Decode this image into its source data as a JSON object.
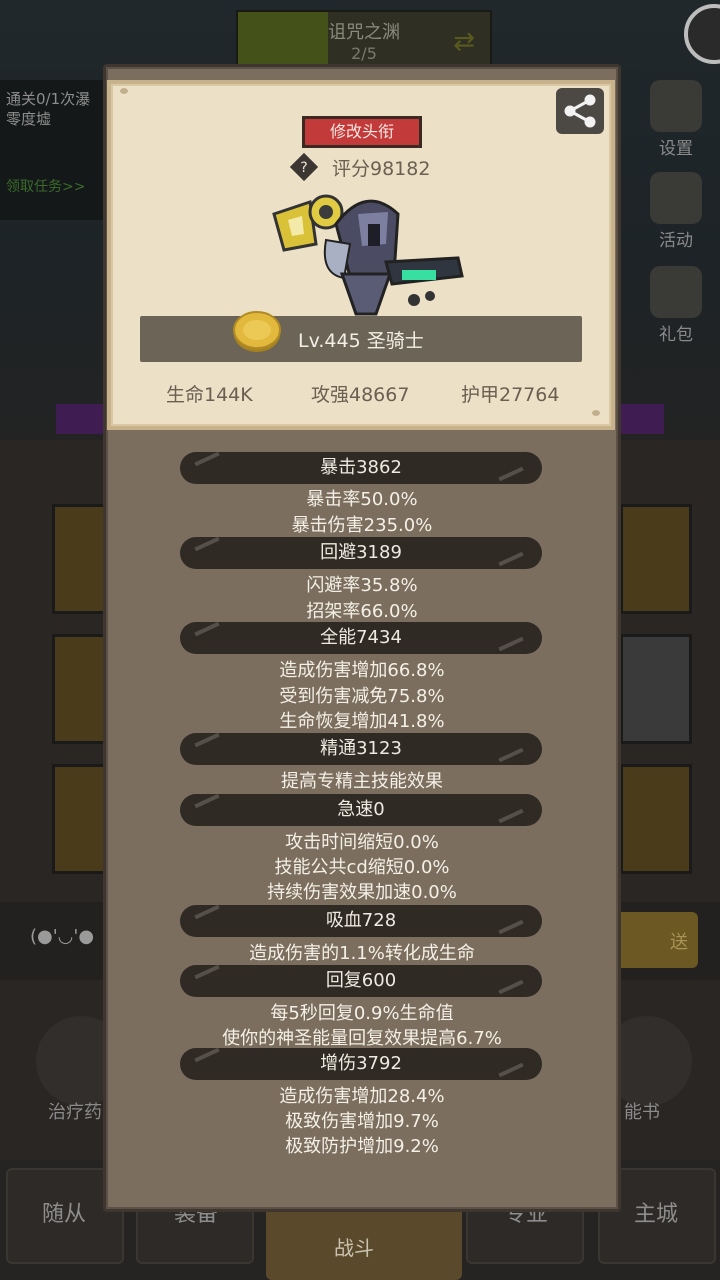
{
  "background": {
    "stage_name": "诅咒之渊",
    "stage_count": "2/5",
    "mission_line1": "通关0/1次瀑",
    "mission_line2": "零度墟",
    "mission_claim": "领取任务>>",
    "side_buttons": [
      "设置",
      "活动",
      "礼包"
    ],
    "emoticon": "(●'◡'●",
    "send_label": "送",
    "left_round_label": "治疗药",
    "right_round_label": "能书",
    "tabs": [
      "随从",
      "装备",
      "战斗",
      "专业",
      "主城"
    ]
  },
  "card": {
    "edit_title_label": "修改头衔",
    "score_label": "评分98182",
    "level_label": "Lv.445 圣骑士",
    "main_stats": [
      "生命144K",
      "攻强48667",
      "护甲27764"
    ]
  },
  "stats": [
    {
      "header": "暴击3862",
      "lines": [
        "暴击率50.0%",
        "暴击伤害235.0%"
      ]
    },
    {
      "header": "回避3189",
      "lines": [
        "闪避率35.8%",
        "招架率66.0%"
      ]
    },
    {
      "header": "全能7434",
      "lines": [
        "造成伤害增加66.8%",
        "受到伤害减免75.8%",
        "生命恢复增加41.8%"
      ]
    },
    {
      "header": "精通3123",
      "lines": [
        "提高专精主技能效果"
      ]
    },
    {
      "header": "急速0",
      "lines": [
        "攻击时间缩短0.0%",
        "技能公共cd缩短0.0%",
        "持续伤害效果加速0.0%"
      ]
    },
    {
      "header": "吸血728",
      "lines": [
        "造成伤害的1.1%转化成生命"
      ]
    },
    {
      "header": "回复600",
      "lines": [
        "每5秒回复0.9%生命值",
        "使你的神圣能量回复效果提高6.7%"
      ]
    },
    {
      "header": "增伤3792",
      "lines": [
        "造成伤害增加28.4%",
        "极致伤害增加9.7%",
        "极致防护增加9.2%"
      ]
    }
  ],
  "colors": {
    "panel_bg": "#7b6e5f",
    "card_bg": "#ece1c6",
    "header_pill": "#2f2a24",
    "edit_button": "#c33a3a"
  }
}
